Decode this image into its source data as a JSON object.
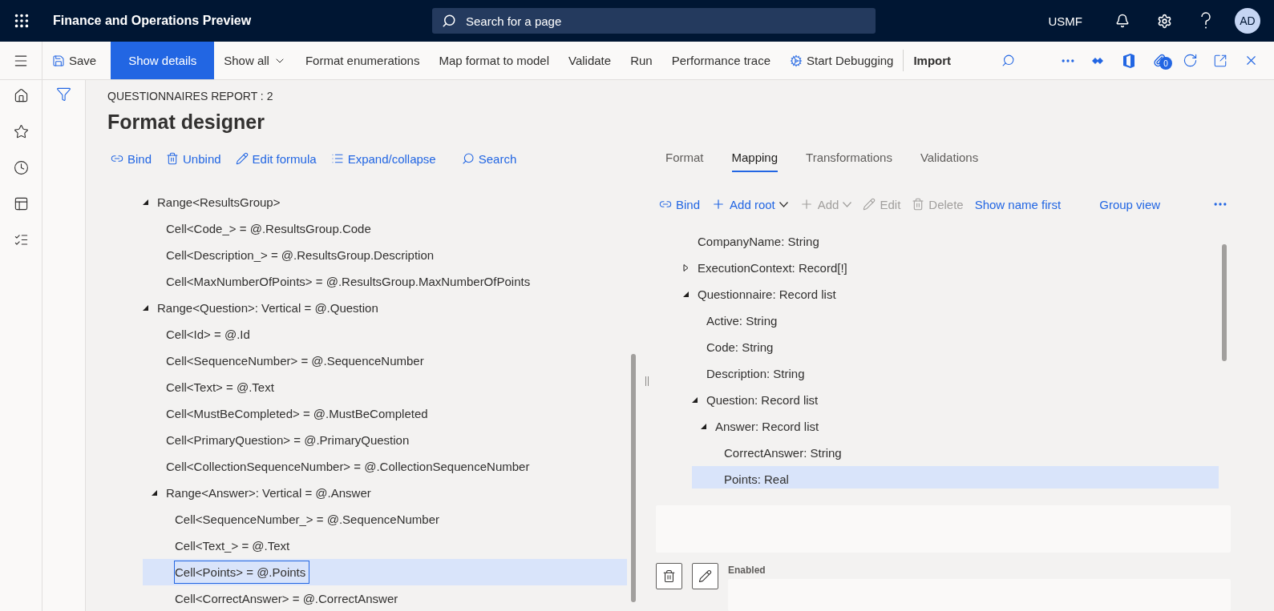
{
  "app_bar": {
    "title": "Finance and Operations Preview",
    "search": {
      "placeholder": "Search for a page"
    },
    "company": "USMF",
    "avatar": "AD"
  },
  "command_bar": {
    "save": "Save",
    "show_details": "Show details",
    "show_all": "Show all",
    "actions": [
      "Format enumerations",
      "Map format to model",
      "Validate",
      "Run",
      "Performance trace"
    ],
    "start_debugging": "Start Debugging",
    "import": "Import",
    "attachments_count": "0"
  },
  "page_header": {
    "caption": "QUESTIONNAIRES REPORT : 2",
    "title": "Format designer"
  },
  "format_toolbar": [
    {
      "kind": "bind",
      "label": "Bind"
    },
    {
      "kind": "unbind",
      "label": "Unbind"
    },
    {
      "kind": "edit",
      "label": "Edit formula"
    },
    {
      "kind": "expand",
      "label": "Expand/collapse"
    },
    {
      "kind": "search",
      "label": "Search"
    }
  ],
  "format_tree": [
    {
      "label": "Range<ResultsGroup>",
      "expanded": true,
      "selected": false,
      "children": [
        {
          "label": "Cell<Code_> = @.ResultsGroup.Code",
          "selected": false
        },
        {
          "label": "Cell<Description_> = @.ResultsGroup.Description",
          "selected": false
        },
        {
          "label": "Cell<MaxNumberOfPoints> = @.ResultsGroup.MaxNumberOfPoints",
          "selected": false
        }
      ]
    },
    {
      "label": "Range<Question>: Vertical = @.Question",
      "expanded": true,
      "selected": false,
      "children": [
        {
          "label": "Cell<Id> = @.Id",
          "selected": false
        },
        {
          "label": "Cell<SequenceNumber> = @.SequenceNumber",
          "selected": false
        },
        {
          "label": "Cell<Text> = @.Text",
          "selected": false
        },
        {
          "label": "Cell<MustBeCompleted> = @.MustBeCompleted",
          "selected": false
        },
        {
          "label": "Cell<PrimaryQuestion> = @.PrimaryQuestion",
          "selected": false
        },
        {
          "label": "Cell<CollectionSequenceNumber> = @.CollectionSequenceNumber",
          "selected": false
        },
        {
          "label": "Range<Answer>: Vertical = @.Answer",
          "expanded": true,
          "selected": false,
          "children": [
            {
              "label": "Cell<SequenceNumber_> = @.SequenceNumber",
              "selected": false
            },
            {
              "label": "Cell<Text_> = @.Text",
              "selected": false
            },
            {
              "label": "Cell<Points> = @.Points",
              "selected": true
            },
            {
              "label": "Cell<CorrectAnswer> = @.CorrectAnswer",
              "selected": false
            }
          ]
        }
      ]
    }
  ],
  "mapping_tabs": [
    {
      "label": "Format",
      "selected": false
    },
    {
      "label": "Mapping",
      "selected": true
    },
    {
      "label": "Transformations",
      "selected": false
    },
    {
      "label": "Validations",
      "selected": false
    }
  ],
  "mapping_toolbar": [
    {
      "kind": "bind",
      "label": "Bind",
      "disabled": false
    },
    {
      "kind": "add-root",
      "label": "Add root",
      "disabled": false
    },
    {
      "kind": "add",
      "label": "Add",
      "disabled": true
    },
    {
      "kind": "edit",
      "label": "Edit",
      "disabled": true
    },
    {
      "kind": "delete",
      "label": "Delete",
      "disabled": true
    },
    {
      "kind": "link",
      "label": "Show name first",
      "disabled": false
    },
    {
      "kind": "link",
      "label": "Group view",
      "disabled": false
    }
  ],
  "mapping_tree": [
    {
      "label": "CompanyName: String",
      "selected": false
    },
    {
      "label": "ExecutionContext: Record[!]",
      "expanded": false,
      "selected": false
    },
    {
      "label": "Questionnaire: Record list",
      "expanded": true,
      "selected": false,
      "children": [
        {
          "label": "Active: String",
          "selected": false
        },
        {
          "label": "Code: String",
          "selected": false
        },
        {
          "label": "Description: String",
          "selected": false
        },
        {
          "label": "Question: Record list",
          "expanded": true,
          "selected": false,
          "children": [
            {
              "label": "Answer: Record list",
              "expanded": true,
              "selected": false,
              "children": [
                {
                  "label": "CorrectAnswer: String",
                  "selected": false
                },
                {
                  "label": "Points: Real",
                  "selected": true
                }
              ]
            }
          ]
        }
      ]
    }
  ],
  "details": {
    "enabled_label": "Enabled"
  }
}
